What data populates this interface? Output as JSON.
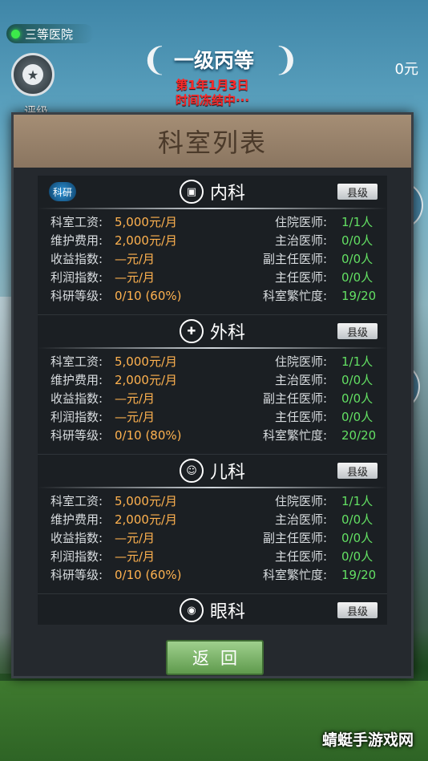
{
  "hud": {
    "hospital_level": "三等医院",
    "rating_label": "评级",
    "rank_title": "一级丙等",
    "date": "第1年1月3日",
    "time_status": "时间冻结中···",
    "money": "0元"
  },
  "dialog": {
    "title": "科室列表",
    "research_badge": "科研",
    "return_label": "返回",
    "departments": [
      {
        "name": "内科",
        "level": "县级",
        "icon": "internal-medicine-icon",
        "salary_label": "科室工资:",
        "salary": "5,000元/月",
        "maintenance_label": "维护费用:",
        "maintenance": "2,000元/月",
        "income_label": "收益指数:",
        "income": "—元/月",
        "profit_label": "利润指数:",
        "profit": "—元/月",
        "research_label": "科研等级:",
        "research": "0/10 (60%)",
        "resident_label": "住院医师:",
        "resident": "1/1人",
        "attending_label": "主治医师:",
        "attending": "0/0人",
        "assoc_chief_label": "副主任医师:",
        "assoc_chief": "0/0人",
        "chief_label": "主任医师:",
        "chief": "0/0人",
        "busy_label": "科室繁忙度:",
        "busy": "19/20"
      },
      {
        "name": "外科",
        "level": "县级",
        "icon": "surgery-icon",
        "salary_label": "科室工资:",
        "salary": "5,000元/月",
        "maintenance_label": "维护费用:",
        "maintenance": "2,000元/月",
        "income_label": "收益指数:",
        "income": "—元/月",
        "profit_label": "利润指数:",
        "profit": "—元/月",
        "research_label": "科研等级:",
        "research": "0/10 (80%)",
        "resident_label": "住院医师:",
        "resident": "1/1人",
        "attending_label": "主治医师:",
        "attending": "0/0人",
        "assoc_chief_label": "副主任医师:",
        "assoc_chief": "0/0人",
        "chief_label": "主任医师:",
        "chief": "0/0人",
        "busy_label": "科室繁忙度:",
        "busy": "20/20"
      },
      {
        "name": "儿科",
        "level": "县级",
        "icon": "pediatrics-icon",
        "salary_label": "科室工资:",
        "salary": "5,000元/月",
        "maintenance_label": "维护费用:",
        "maintenance": "2,000元/月",
        "income_label": "收益指数:",
        "income": "—元/月",
        "profit_label": "利润指数:",
        "profit": "—元/月",
        "research_label": "科研等级:",
        "research": "0/10 (60%)",
        "resident_label": "住院医师:",
        "resident": "1/1人",
        "attending_label": "主治医师:",
        "attending": "0/0人",
        "assoc_chief_label": "副主任医师:",
        "assoc_chief": "0/0人",
        "chief_label": "主任医师:",
        "chief": "0/0人",
        "busy_label": "科室繁忙度:",
        "busy": "19/20"
      },
      {
        "name": "眼科",
        "level": "县级",
        "icon": "eye-icon"
      }
    ]
  },
  "watermark": "蜻蜓手游戏网",
  "colors": {
    "value_orange": "#ffb24f",
    "value_green": "#63e063",
    "alert_red": "#ff2a2a"
  }
}
